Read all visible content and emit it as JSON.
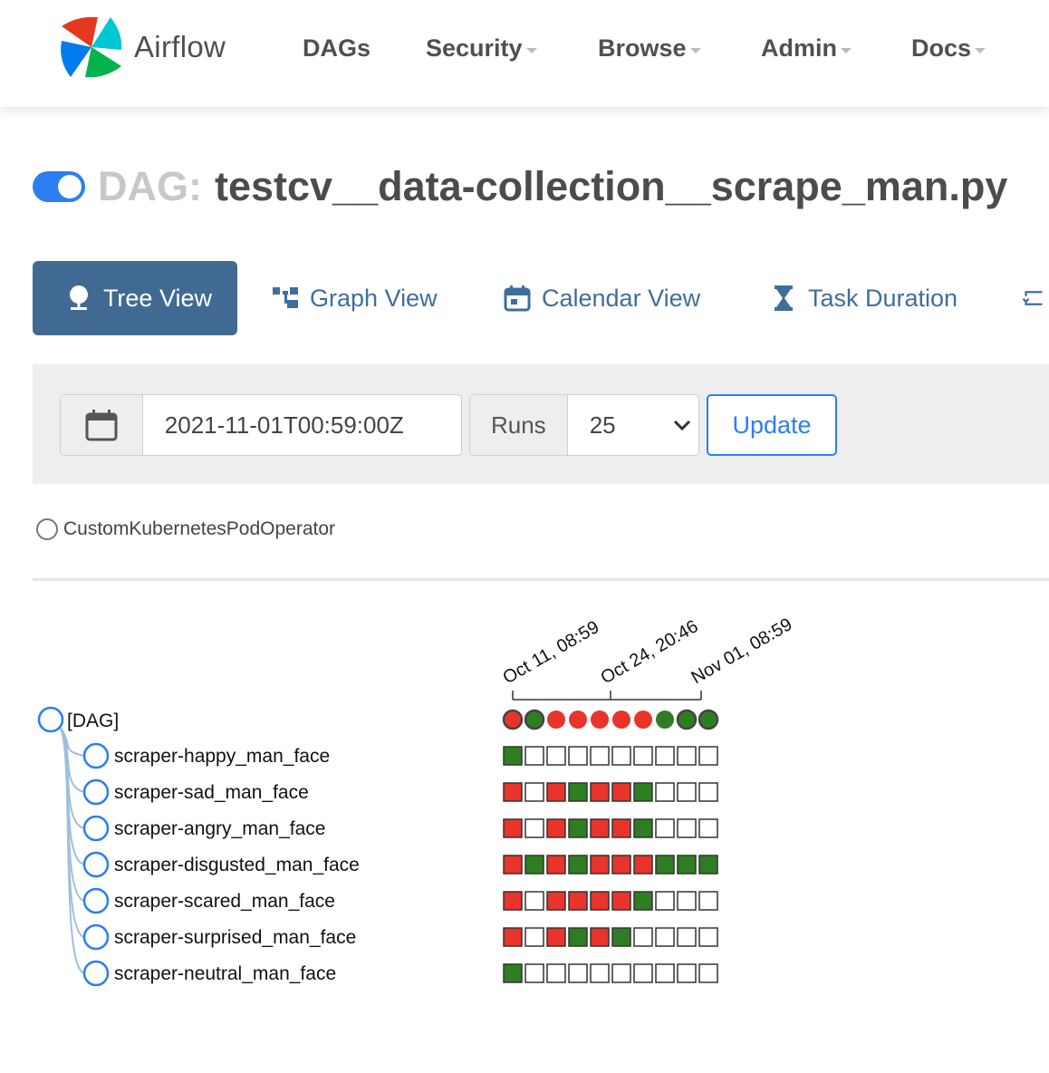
{
  "navbar": {
    "brand": "Airflow",
    "items": [
      {
        "label": "DAGs",
        "dropdown": false
      },
      {
        "label": "Security",
        "dropdown": true
      },
      {
        "label": "Browse",
        "dropdown": true
      },
      {
        "label": "Admin",
        "dropdown": true
      },
      {
        "label": "Docs",
        "dropdown": true
      }
    ]
  },
  "dag": {
    "prefix": "DAG:",
    "name": "testcv__data-collection__scrape_man.py",
    "paused": false
  },
  "tabs": [
    {
      "label": "Tree View",
      "icon": "tree-icon",
      "active": true
    },
    {
      "label": "Graph View",
      "icon": "graph-icon",
      "active": false
    },
    {
      "label": "Calendar View",
      "icon": "calendar-icon",
      "active": false
    },
    {
      "label": "Task Duration",
      "icon": "hourglass-icon",
      "active": false
    }
  ],
  "controls": {
    "base_date": "2021-11-01T00:59:00Z",
    "runs_label": "Runs",
    "runs_value": "25",
    "update_label": "Update"
  },
  "legend": {
    "operator": "CustomKubernetesPodOperator"
  },
  "colors": {
    "success": "#2f7d22",
    "failed": "#e8342a",
    "none": "#ffffff",
    "accent": "#2d7ef0",
    "tab_active": "#416a92"
  },
  "chart_data": {
    "type": "table",
    "date_labels": [
      "Oct 11, 08:59",
      "Oct 24, 20:46",
      "Nov 01, 08:59"
    ],
    "dag_label": "[DAG]",
    "dag_runs": [
      "failed",
      "success",
      "failed",
      "failed",
      "failed",
      "failed",
      "failed",
      "success",
      "success",
      "success"
    ],
    "tasks": [
      {
        "name": "scraper-happy_man_face",
        "states": [
          "success",
          "none",
          "none",
          "none",
          "none",
          "none",
          "none",
          "none",
          "none",
          "none"
        ]
      },
      {
        "name": "scraper-sad_man_face",
        "states": [
          "failed",
          "none",
          "failed",
          "success",
          "failed",
          "failed",
          "success",
          "none",
          "none",
          "none"
        ]
      },
      {
        "name": "scraper-angry_man_face",
        "states": [
          "failed",
          "none",
          "failed",
          "success",
          "failed",
          "failed",
          "success",
          "none",
          "none",
          "none"
        ]
      },
      {
        "name": "scraper-disgusted_man_face",
        "states": [
          "failed",
          "success",
          "failed",
          "success",
          "failed",
          "failed",
          "failed",
          "success",
          "success",
          "success"
        ]
      },
      {
        "name": "scraper-scared_man_face",
        "states": [
          "failed",
          "none",
          "failed",
          "failed",
          "failed",
          "failed",
          "success",
          "none",
          "none",
          "none"
        ]
      },
      {
        "name": "scraper-surprised_man_face",
        "states": [
          "failed",
          "none",
          "failed",
          "success",
          "failed",
          "success",
          "none",
          "none",
          "none",
          "none"
        ]
      },
      {
        "name": "scraper-neutral_man_face",
        "states": [
          "success",
          "none",
          "none",
          "none",
          "none",
          "none",
          "none",
          "none",
          "none",
          "none"
        ]
      }
    ]
  }
}
